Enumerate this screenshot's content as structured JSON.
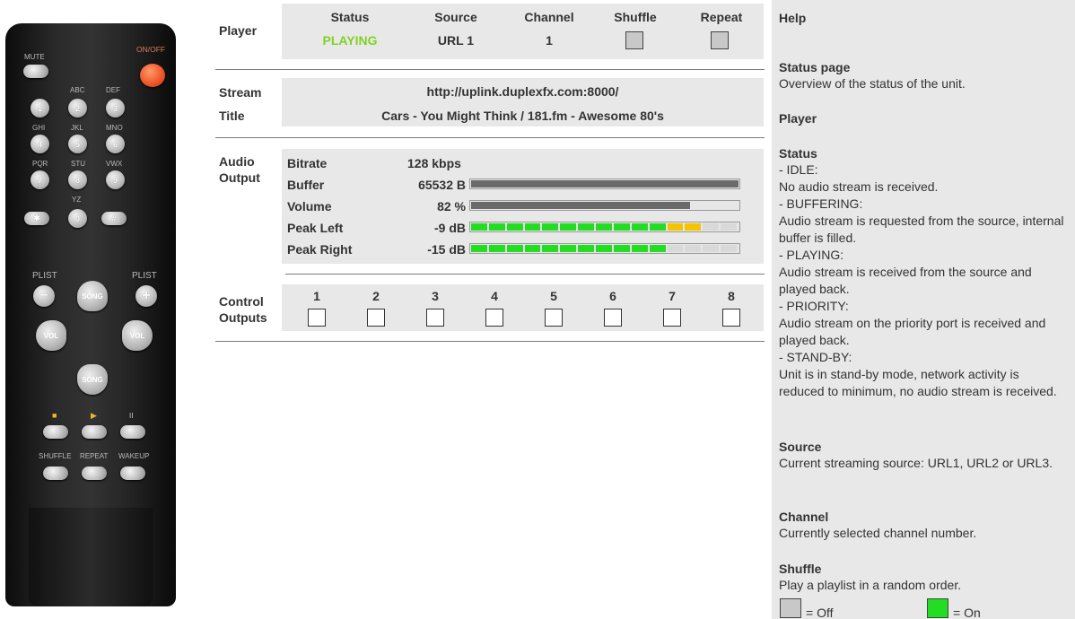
{
  "remote": {
    "mute": "MUTE",
    "on_off": "ON/OFF",
    "letters": [
      "ABC",
      "DEF",
      "GHI",
      "JKL",
      "MNO",
      "PQR",
      "STU",
      "VWX",
      "YZ"
    ],
    "digits": [
      "1",
      "2",
      "3",
      "4",
      "5",
      "6",
      "7",
      "8",
      "9",
      "0"
    ],
    "star": "✱",
    "hash": "#",
    "plist_left": "PLIST",
    "plist_right": "PLIST",
    "minus": "−",
    "plus": "+",
    "song_up": "SONG",
    "song_down": "SONG",
    "vol_left": "VOL",
    "vol_right": "VOL",
    "stop": "■",
    "play": "▶",
    "pause": "II",
    "shuffle": "SHUFFLE",
    "repeat": "REPEAT",
    "wakeup": "WAKEUP"
  },
  "player": {
    "label": "Player",
    "headers": [
      "Status",
      "Source",
      "Channel",
      "Shuffle",
      "Repeat"
    ],
    "status": "PLAYING",
    "source": "URL 1",
    "channel": "1",
    "shuffle_on": false,
    "repeat_on": false,
    "status_color": "#7ed321"
  },
  "stream": {
    "stream_label": "Stream",
    "title_label": "Title",
    "url": "http://uplink.duplexfx.com:8000/",
    "title": "Cars - You Might Think / 181.fm - Awesome 80's"
  },
  "audio": {
    "label_line1": "Audio",
    "label_line2": "Output",
    "rows": [
      {
        "label": "Bitrate",
        "value": "128 kbps"
      },
      {
        "label": "Buffer",
        "value": "65532 B",
        "level": 1.0
      },
      {
        "label": "Volume",
        "value": "82 %",
        "level": 0.82
      },
      {
        "label": "Peak Left",
        "value": "-9 dB",
        "green_segments": 11,
        "yellow_segments": 2,
        "total_segments": 15
      },
      {
        "label": "Peak Right",
        "value": "-15 dB",
        "green_segments": 11,
        "yellow_segments": 0,
        "total_segments": 15
      }
    ],
    "colors": {
      "green": "#22dd22",
      "yellow": "#f5c400",
      "empty": "#d9d9d9"
    }
  },
  "control": {
    "label_line1": "Control",
    "label_line2": "Outputs",
    "numbers": [
      "1",
      "2",
      "3",
      "4",
      "5",
      "6",
      "7",
      "8"
    ]
  },
  "help": {
    "title": "Help",
    "status_page_title": "Status page",
    "status_page_text": "Overview of the status of the unit.",
    "player_title": "Player",
    "status_title": "Status",
    "status_lines": [
      "- IDLE:",
      "No audio stream is received.",
      "- BUFFERING:",
      "Audio stream is requested from the source, internal buffer is filled.",
      "- PLAYING:",
      "Audio stream is received from the source and played back.",
      "- PRIORITY:",
      "Audio stream on the priority port is received and played back.",
      "- STAND-BY:",
      "Unit is in stand-by mode, network activity is reduced to minimum, no audio stream is received."
    ],
    "source_title": "Source",
    "source_text": "Current streaming source: URL1, URL2 or URL3.",
    "channel_title": "Channel",
    "channel_text": "Currently selected channel number.",
    "shuffle_title": "Shuffle",
    "shuffle_text": "Play a playlist in a random order.",
    "off_label": "= Off",
    "on_label": "= On",
    "off_color": "#c8c8c8",
    "on_color": "#22dd22"
  }
}
